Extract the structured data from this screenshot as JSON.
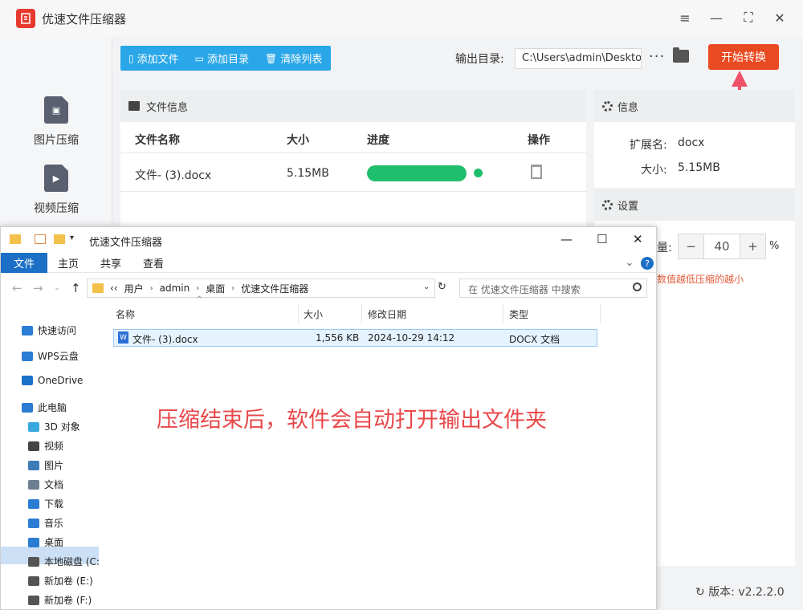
{
  "app": {
    "title": "优速文件压缩器",
    "sidebar": [
      {
        "label": "图片压缩",
        "icon": "image-file-icon"
      },
      {
        "label": "视频压缩",
        "icon": "video-file-icon"
      }
    ],
    "toolbar": {
      "add_file": "添加文件",
      "add_dir": "添加目录",
      "clear_list": "清除列表",
      "output_label": "输出目录:",
      "output_path": "C:\\Users\\admin\\Deskto",
      "more": "···",
      "start": "开始转换"
    },
    "file_panel": {
      "title": "文件信息",
      "headers": {
        "name": "文件名称",
        "size": "大小",
        "progress": "进度",
        "action": "操作"
      },
      "rows": [
        {
          "name": "文件- (3).docx",
          "size": "5.15MB",
          "progress": 1.0
        }
      ]
    },
    "info": {
      "title": "信息",
      "ext_label": "扩展名:",
      "ext_value": "docx",
      "size_label": "大小:",
      "size_value": "5.15MB"
    },
    "settings": {
      "title": "设置",
      "quality_label_partial": "量:",
      "quality_value": "40",
      "unit": "%",
      "hint": "数值越低压缩的越小"
    },
    "version_label": "版本:",
    "version_value": "v2.2.2.0"
  },
  "explorer": {
    "title": "优速文件压缩器",
    "tabs": [
      "文件",
      "主页",
      "共享",
      "查看"
    ],
    "breadcrumb": [
      "‹‹",
      "用户",
      "admin",
      "桌面",
      "优速文件压缩器"
    ],
    "search_placeholder": "在 优速文件压缩器 中搜索",
    "nav": [
      {
        "label": "快速访问",
        "icon": "star-icon",
        "color": "#2b7cd3"
      },
      {
        "label": "WPS云盘",
        "icon": "cloud-icon",
        "color": "#2b7cd3"
      },
      {
        "label": "OneDrive",
        "icon": "onedrive-icon",
        "color": "#1a73c9"
      },
      {
        "label": "此电脑",
        "icon": "computer-icon",
        "color": "#2b7cd3"
      },
      {
        "label": "3D 对象",
        "icon": "cube-icon",
        "color": "#39a8e0"
      },
      {
        "label": "视频",
        "icon": "film-icon",
        "color": "#444444"
      },
      {
        "label": "图片",
        "icon": "picture-icon",
        "color": "#3d7ab8"
      },
      {
        "label": "文档",
        "icon": "document-icon",
        "color": "#6e7f91"
      },
      {
        "label": "下载",
        "icon": "download-icon",
        "color": "#2b7cd3"
      },
      {
        "label": "音乐",
        "icon": "music-icon",
        "color": "#2b7cd3"
      },
      {
        "label": "桌面",
        "icon": "desktop-icon",
        "color": "#2b7cd3"
      },
      {
        "label": "本地磁盘 (C:",
        "icon": "drive-icon",
        "color": "#555555"
      },
      {
        "label": "新加卷 (E:)",
        "icon": "drive-icon",
        "color": "#555555"
      },
      {
        "label": "新加卷 (F:)",
        "icon": "drive-icon",
        "color": "#555555"
      }
    ],
    "columns": {
      "name": "名称",
      "size": "大小",
      "modified": "修改日期",
      "type": "类型"
    },
    "files": [
      {
        "name": "文件- (3).docx",
        "size": "1,556 KB",
        "modified": "2024-10-29 14:12",
        "type": "DOCX 文档"
      }
    ]
  },
  "annotation": "压缩结束后，软件会自动打开输出文件夹",
  "colors": {
    "accent": "#2aa7e8",
    "start": "#ea4a22",
    "progress": "#1fbe6c",
    "annotation": "#e8484a"
  }
}
